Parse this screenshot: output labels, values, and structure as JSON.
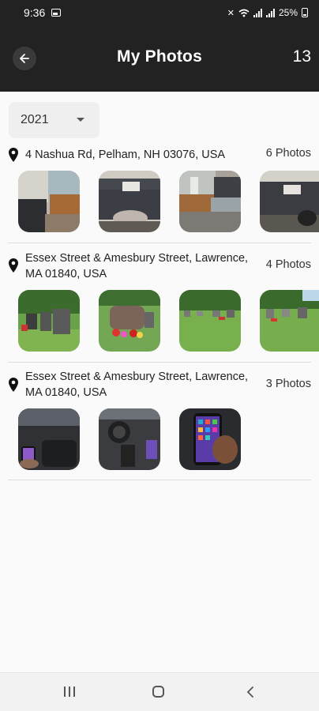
{
  "status_bar": {
    "time": "9:36",
    "battery": "25%"
  },
  "header": {
    "title": "My Photos",
    "count": "13"
  },
  "filter": {
    "year": "2021"
  },
  "groups": [
    {
      "location": "4 Nashua Rd, Pelham, NH 03076, USA",
      "count": "6 Photos"
    },
    {
      "location": "Essex Street & Amesbury Street, Lawrence, MA 01840, USA",
      "count": "4 Photos"
    },
    {
      "location": "Essex Street & Amesbury Street, Lawrence, MA 01840, USA",
      "count": "3 Photos"
    }
  ],
  "colors": {
    "header_bg": "#222222",
    "page_bg": "#fafafa",
    "divider": "#dcdcdc"
  }
}
